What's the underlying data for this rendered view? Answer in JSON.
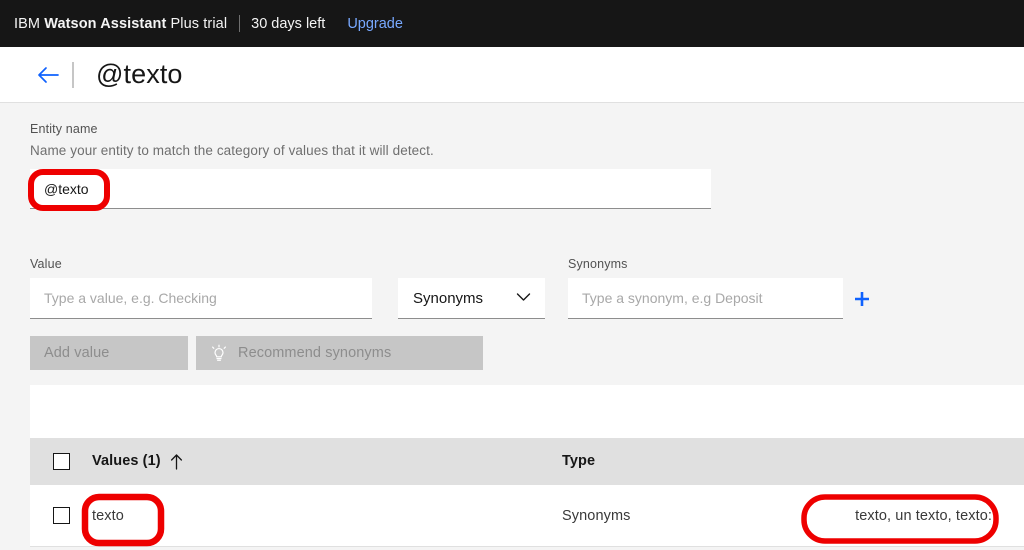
{
  "trial_bar": {
    "brand_prefix": "IBM ",
    "brand_bold": "Watson Assistant",
    "brand_suffix": " Plus trial",
    "days_left": "30 days left",
    "upgrade_label": "Upgrade",
    "background": "#161616",
    "link_color": "#78a9ff"
  },
  "page_header": {
    "back_icon": "arrow-left-icon",
    "title": "@texto",
    "back_color": "#0f62fe"
  },
  "entity_name": {
    "label": "Entity name",
    "help": "Name your entity to match the category of values that it will detect.",
    "value": "@texto",
    "placeholder": ""
  },
  "value_row": {
    "value_label": "Value",
    "value_placeholder": "Type a value, e.g. Checking",
    "value_text": "",
    "type_selected": "Synonyms",
    "type_chevron_icon": "chevron-down-icon",
    "synonyms_label": "Synonyms",
    "synonyms_placeholder": "Type a synonym, e.g Deposit",
    "synonyms_text": "",
    "add_icon": "plus-icon",
    "add_icon_color": "#0f62fe"
  },
  "actions": {
    "add_value_label": "Add value",
    "recommend_label": "Recommend synonyms",
    "recommend_icon": "idea-bulb-icon",
    "disabled_bg": "#c6c6c6",
    "disabled_fg": "#8d8d8d"
  },
  "table": {
    "columns": [
      "Values (1)",
      "Type",
      ""
    ],
    "values_header": "Values (1)",
    "sort_icon": "sort-ascending-arrow-icon",
    "type_header": "Type",
    "select_all_checkbox": "unchecked",
    "rows": [
      {
        "checkbox": "unchecked",
        "value": "texto",
        "type": "Synonyms",
        "synonyms": "texto, un texto, texto:"
      }
    ]
  },
  "annotations": {
    "color": "#ee0000",
    "marks": [
      {
        "name": "entity-name-highlight",
        "target": "@texto"
      },
      {
        "name": "value-cell-highlight",
        "target": "texto"
      },
      {
        "name": "synonyms-cell-highlight",
        "target": "texto, un texto, texto:"
      }
    ]
  }
}
